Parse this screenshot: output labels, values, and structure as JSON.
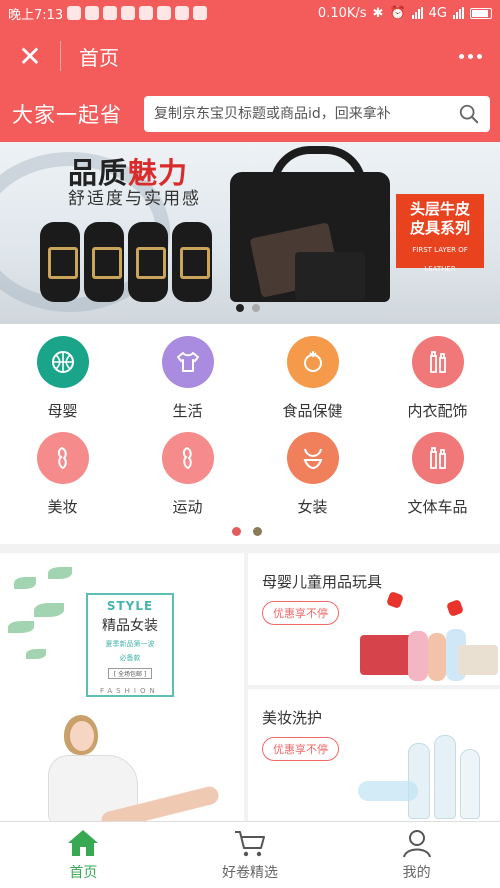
{
  "status_bar": {
    "time": "晚上7:13",
    "net_speed": "0.10K/s",
    "network": "4G"
  },
  "titlebar": {
    "close_glyph": "✕",
    "title": "首页",
    "more_icon": "more-dots-icon"
  },
  "search": {
    "slogan": "大家一起省",
    "placeholder": "复制京东宝贝标题或商品id，回来拿补",
    "icon": "search-icon"
  },
  "banner": {
    "headline_plain": "品质",
    "headline_accent": "魅力",
    "subline": "舒适度与实用感",
    "tag_line1": "头层牛皮",
    "tag_line2": "皮具系列",
    "tag_small": "FIRST LAYER OF LEATHER",
    "active_dot": 0,
    "dot_count": 2
  },
  "categories": [
    {
      "label": "母婴",
      "icon": "basketball-icon",
      "color": "#1aa58a"
    },
    {
      "label": "生活",
      "icon": "tshirt-icon",
      "color": "#a98be0"
    },
    {
      "label": "食品保健",
      "icon": "food-icon",
      "color": "#f49a4a"
    },
    {
      "label": "内衣配饰",
      "icon": "bottles-icon",
      "color": "#f07878"
    },
    {
      "label": "美妆",
      "icon": "figure-icon",
      "color": "#f58b8b"
    },
    {
      "label": "运动",
      "icon": "figure-icon",
      "color": "#f58b8b"
    },
    {
      "label": "女装",
      "icon": "bikini-icon",
      "color": "#f07f5c"
    },
    {
      "label": "文体车品",
      "icon": "bottles-icon",
      "color": "#f07878"
    }
  ],
  "category_pager": {
    "colors": [
      "#e35b5b",
      "#8a7a5a"
    ]
  },
  "promo_left": {
    "style_label": "STYLE",
    "name": "精品女装",
    "line1": "夏季新品第一波",
    "line2": "必备款",
    "button": "[ 全场包邮 ]",
    "fashion": "FASHION"
  },
  "promo_cards": [
    {
      "title": "母婴儿童用品玩具",
      "badge": "优惠享不停"
    },
    {
      "title": "美妆洗护",
      "badge": "优惠享不停"
    }
  ],
  "tabs": [
    {
      "label": "首页",
      "icon": "home-icon",
      "active": true
    },
    {
      "label": "好卷精选",
      "icon": "cart-icon",
      "active": false
    },
    {
      "label": "我的",
      "icon": "user-icon",
      "active": false
    }
  ],
  "colors": {
    "brand": "#f45b5b",
    "tab_active": "#39a852"
  }
}
